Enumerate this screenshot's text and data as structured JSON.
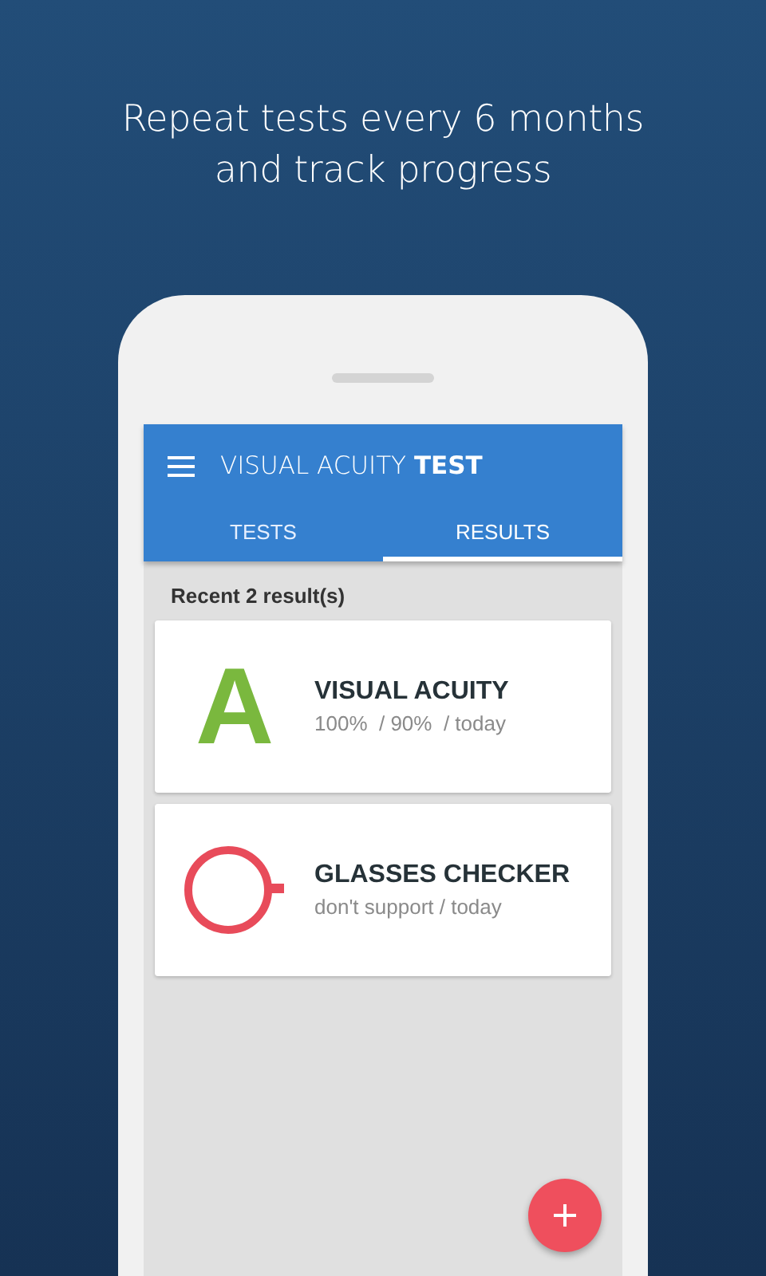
{
  "headline": [
    "Repeat tests every 6 months",
    "and track progress"
  ],
  "app_bar": {
    "title": "VISUAL ACUITY **TEST**"
  },
  "tabs": [
    {
      "label": "TESTS",
      "selected": false
    },
    {
      "label": "RESULTS",
      "selected": true
    }
  ],
  "section_title": "Recent 2 result(s)",
  "results": [
    {
      "kind": "letter",
      "icon_text": "A",
      "color": "#7ab83e",
      "name": "VISUAL ACUITY",
      "detail": "100%  / 90%  / today"
    },
    {
      "kind": "ring",
      "color": "#e84b5a",
      "name": "GLASSES CHECKER",
      "detail": "don't support / today"
    }
  ]
}
